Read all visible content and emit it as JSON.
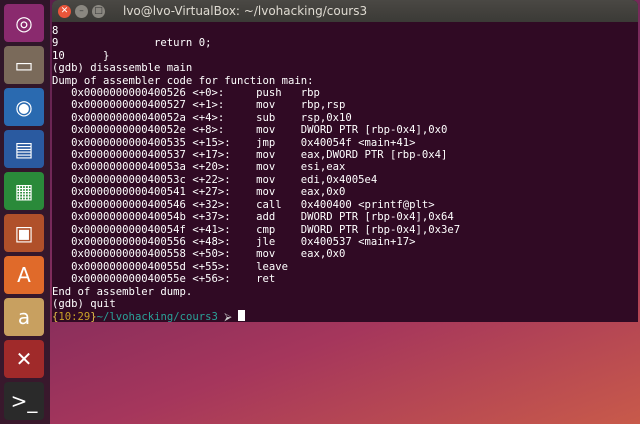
{
  "launcher": {
    "items": [
      {
        "name": "ubuntu-dash",
        "icon": "ubuntu-logo-icon",
        "color": "#8a2a6e"
      },
      {
        "name": "files",
        "icon": "file-cabinet-icon",
        "color": "#7a6a5a"
      },
      {
        "name": "firefox",
        "icon": "firefox-icon",
        "color": "#2a6ab0"
      },
      {
        "name": "libreoffice-writer",
        "icon": "writer-icon",
        "color": "#2a5aa0"
      },
      {
        "name": "libreoffice-calc",
        "icon": "calc-icon",
        "color": "#2a8a3a"
      },
      {
        "name": "libreoffice-impress",
        "icon": "impress-icon",
        "color": "#b0502a"
      },
      {
        "name": "software-center",
        "icon": "shopping-bag-icon",
        "color": "#e06a2a"
      },
      {
        "name": "amazon",
        "icon": "amazon-icon",
        "color": "#c8a060"
      },
      {
        "name": "system-settings",
        "icon": "settings-icon",
        "color": "#a02a2a"
      },
      {
        "name": "terminal",
        "icon": "terminal-icon",
        "color": "#2a2a2a"
      }
    ],
    "glyphs": [
      "◎",
      "▭",
      "◉",
      "▤",
      "▦",
      "▣",
      "A",
      "a",
      "✕",
      ">_"
    ]
  },
  "window": {
    "title": "lvo@lvo-VirtualBox: ~/lvohacking/cours3"
  },
  "terminal": {
    "lines": [
      "8",
      "9               return 0;",
      "10      }",
      "(gdb) disassemble main",
      "Dump of assembler code for function main:",
      "   0x0000000000400526 <+0>:     push   rbp",
      "   0x0000000000400527 <+1>:     mov    rbp,rsp",
      "   0x000000000040052a <+4>:     sub    rsp,0x10",
      "   0x000000000040052e <+8>:     mov    DWORD PTR [rbp-0x4],0x0",
      "   0x0000000000400535 <+15>:    jmp    0x40054f <main+41>",
      "   0x0000000000400537 <+17>:    mov    eax,DWORD PTR [rbp-0x4]",
      "   0x000000000040053a <+20>:    mov    esi,eax",
      "   0x000000000040053c <+22>:    mov    edi,0x4005e4",
      "   0x0000000000400541 <+27>:    mov    eax,0x0",
      "   0x0000000000400546 <+32>:    call   0x400400 <printf@plt>",
      "   0x000000000040054b <+37>:    add    DWORD PTR [rbp-0x4],0x64",
      "   0x000000000040054f <+41>:    cmp    DWORD PTR [rbp-0x4],0x3e7",
      "   0x0000000000400556 <+48>:    jle    0x400537 <main+17>",
      "   0x0000000000400558 <+50>:    mov    eax,0x0",
      "   0x000000000040055d <+55>:    leave",
      "   0x000000000040055e <+56>:    ret",
      "End of assembler dump.",
      "(gdb) quit"
    ],
    "prompt": {
      "open": "{",
      "time": "10:29",
      "close": "}",
      "path": "~/lvohacking/cours3",
      "arrow": "⮚"
    }
  }
}
